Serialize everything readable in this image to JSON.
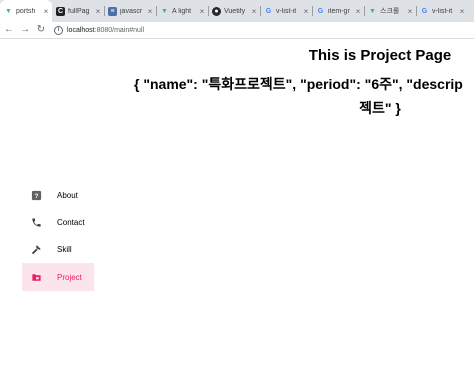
{
  "browser": {
    "tabs": [
      {
        "favicon": "vue-logo-icon",
        "title": "portsh",
        "active": true
      },
      {
        "favicon": "c-icon",
        "title": "fullPag",
        "active": false
      },
      {
        "favicon": "stackoverflow-icon",
        "title": "javascr",
        "active": false
      },
      {
        "favicon": "vue-logo-icon",
        "title": "A light",
        "active": false
      },
      {
        "favicon": "github-icon",
        "title": "Vuetify",
        "active": false
      },
      {
        "favicon": "google-icon",
        "title": "v-list-it",
        "active": false
      },
      {
        "favicon": "google-icon",
        "title": "item-gr",
        "active": false
      },
      {
        "favicon": "vue-logo-icon",
        "title": "스크롤",
        "active": false
      },
      {
        "favicon": "google-icon",
        "title": "v-list-it",
        "active": false
      }
    ],
    "url_host": "localhost",
    "url_rest": ":8080/main#null"
  },
  "page": {
    "title": "This is Project Page",
    "json_line1": "{ \"name\": \"특화프로젝트\", \"period\": \"6주\", \"descrip",
    "json_line2": "젝트\" }"
  },
  "nav": {
    "items": [
      {
        "icon": "help-box-icon",
        "label": "About",
        "active": false
      },
      {
        "icon": "phone-icon",
        "label": "Contact",
        "active": false
      },
      {
        "icon": "hammer-icon",
        "label": "Skill",
        "active": false
      },
      {
        "icon": "folder-icon",
        "label": "Project",
        "active": true
      }
    ]
  },
  "colors": {
    "active_bg": "#fce4ec",
    "active_fg": "#e91e63"
  }
}
